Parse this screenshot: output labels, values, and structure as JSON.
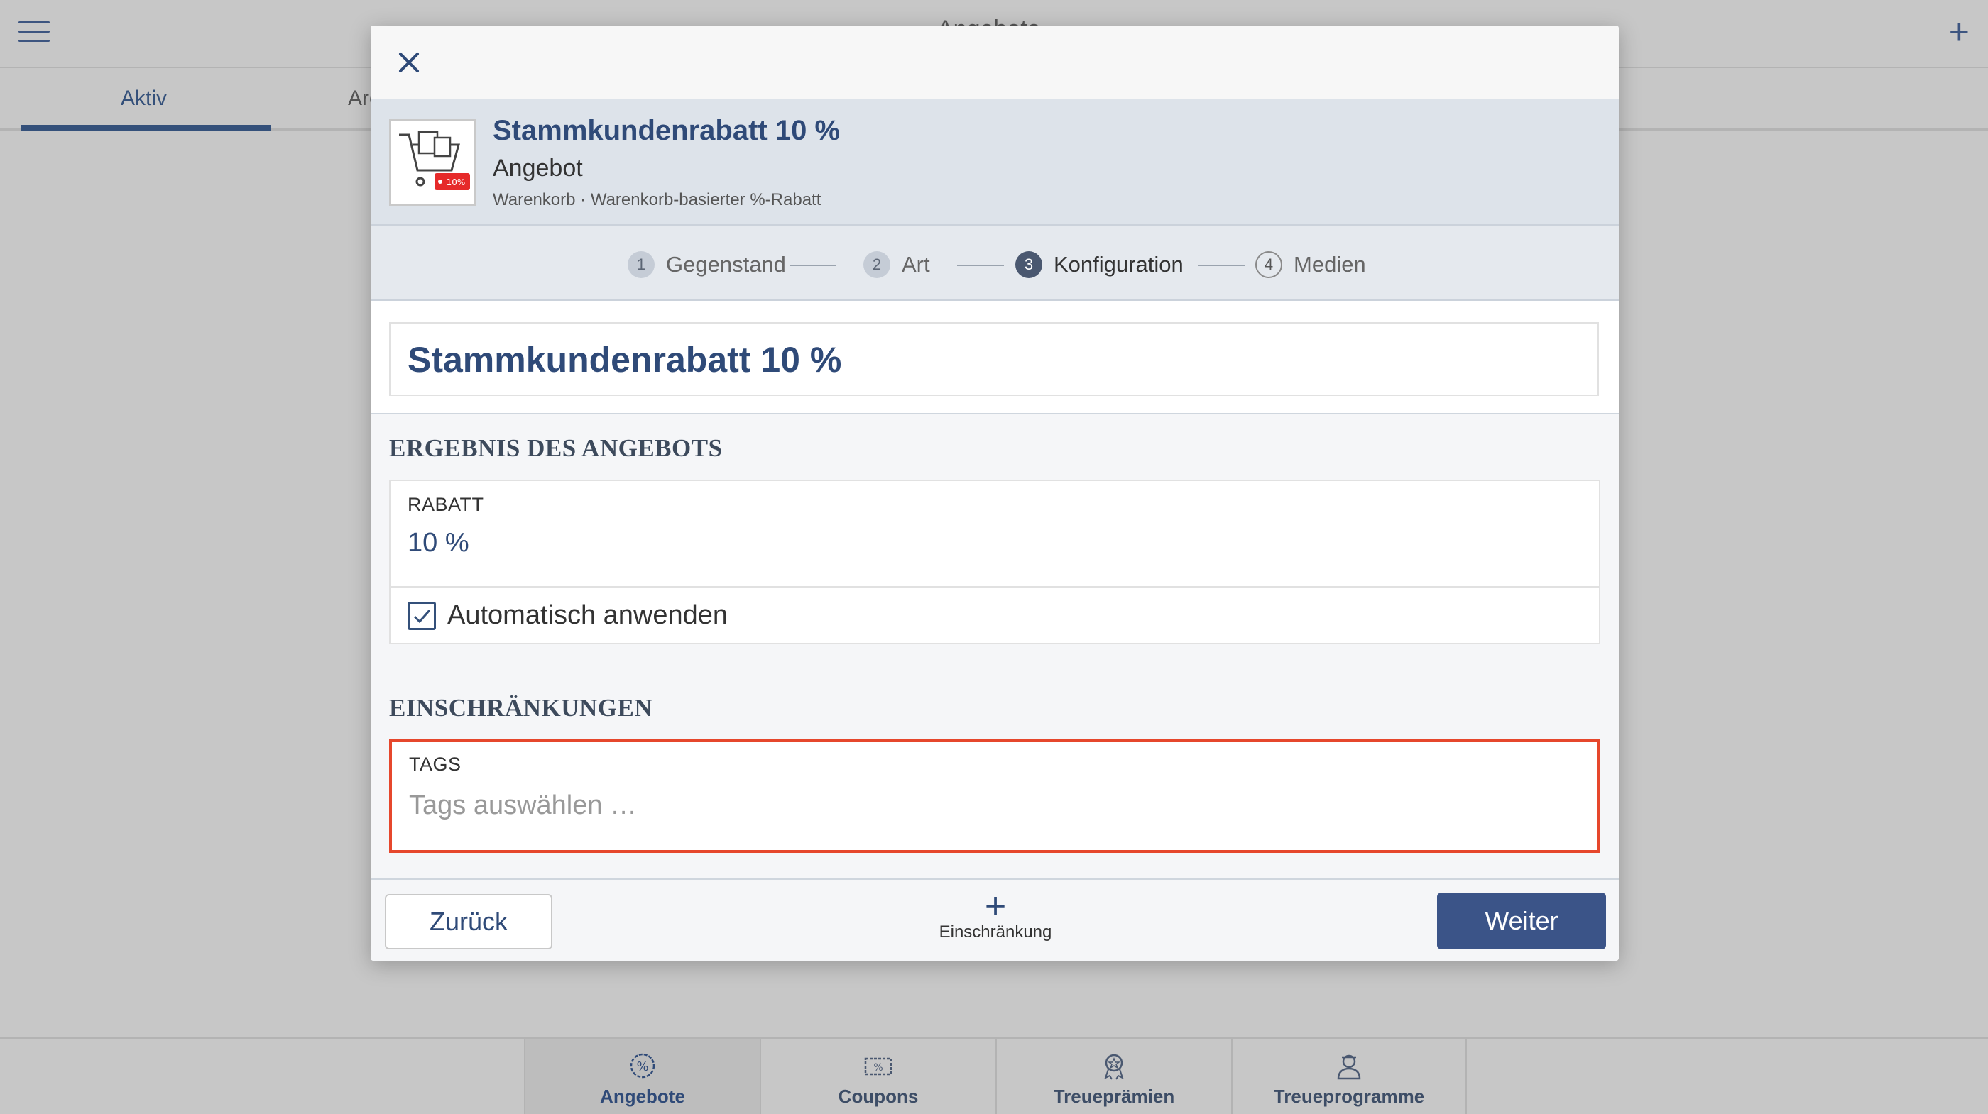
{
  "app": {
    "title": "Angebote",
    "tabs": [
      {
        "label": "Aktiv"
      },
      {
        "label": "Archiv"
      }
    ]
  },
  "bottom_nav": [
    {
      "label": "Angebote",
      "icon": "percent-badge-icon",
      "active": true
    },
    {
      "label": "Coupons",
      "icon": "coupon-icon",
      "active": false
    },
    {
      "label": "Treueprämien",
      "icon": "reward-medal-icon",
      "active": false
    },
    {
      "label": "Treueprogramme",
      "icon": "loyalty-person-icon",
      "active": false
    }
  ],
  "modal": {
    "offer": {
      "name": "Stammkundenrabatt 10 %",
      "type": "Angebot",
      "subtitle": "Warenkorb · Warenkorb-basierter %-Rabatt",
      "thumb_badge": "10%"
    },
    "steps": [
      {
        "num": "1",
        "label": "Gegenstand",
        "state": "done"
      },
      {
        "num": "2",
        "label": "Art",
        "state": "done"
      },
      {
        "num": "3",
        "label": "Konfiguration",
        "state": "current"
      },
      {
        "num": "4",
        "label": "Medien",
        "state": "future"
      }
    ],
    "name_value": "Stammkundenrabatt 10 %",
    "result_section": {
      "title": "ERGEBNIS DES ANGEBOTS",
      "discount_label": "RABATT",
      "discount_value": "10 %",
      "auto_apply_label": "Automatisch anwenden",
      "auto_apply_checked": true
    },
    "restrictions_section": {
      "title": "EINSCHRÄNKUNGEN",
      "tags_label": "TAGS",
      "tags_placeholder": "Tags auswählen …"
    },
    "footer": {
      "back_label": "Zurück",
      "add_restriction_label": "Einschränkung",
      "next_label": "Weiter"
    }
  },
  "colors": {
    "accent": "#2f4a78",
    "primary_button": "#3b5488",
    "highlight_border": "#e6472c",
    "overlay": "#c7c7c7"
  }
}
